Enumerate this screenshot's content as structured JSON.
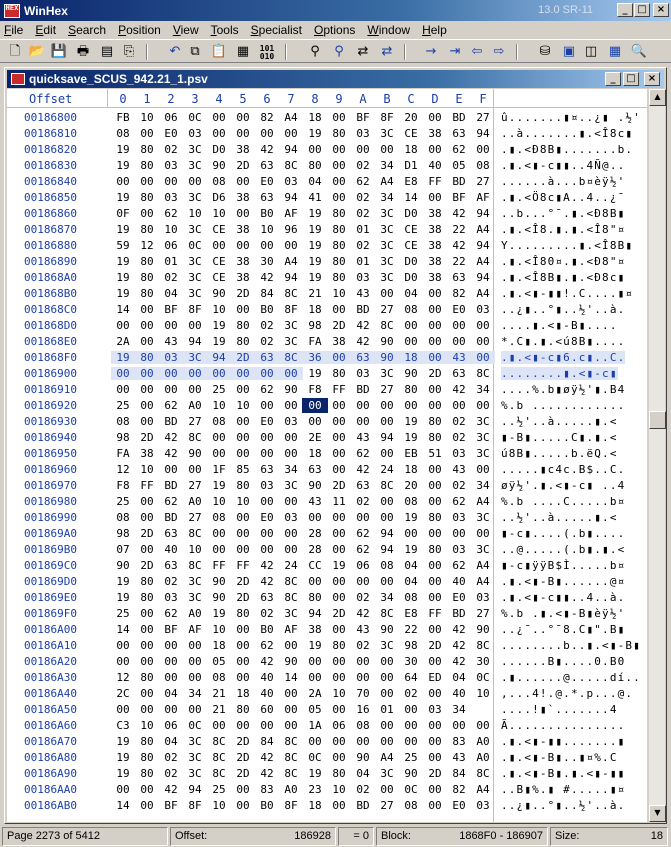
{
  "app": {
    "icon_text": "HEX",
    "title": "WinHex",
    "version": "13.0 SR-11"
  },
  "menu": [
    "File",
    "Edit",
    "Search",
    "Position",
    "View",
    "Tools",
    "Specialist",
    "Options",
    "Window",
    "Help"
  ],
  "toolbar": {
    "icons": [
      "new-file-icon",
      "open-folder-icon",
      "save-disk-icon",
      "print-icon",
      "properties-icon",
      "undo-icon",
      "copy-icon",
      "clipboard-icon",
      "paste-icon",
      "write-icon",
      "binary-convert-icon",
      "find-text-icon",
      "find-hex-icon",
      "replace-text-icon",
      "replace-hex-icon",
      "goto-offset-icon",
      "goto-sector-icon",
      "back-icon",
      "forward-icon",
      "disk-editor-icon",
      "ram-editor-icon",
      "position-manager-icon",
      "calculator-icon",
      "view-icon"
    ]
  },
  "editor": {
    "file_title": "quicksave_SCUS_942.21_1.psv",
    "header": {
      "offset_label": "Offset",
      "columns": [
        "0",
        "1",
        "2",
        "3",
        "4",
        "5",
        "6",
        "7",
        "8",
        "9",
        "A",
        "B",
        "C",
        "D",
        "E",
        "F"
      ]
    },
    "rows": [
      {
        "off": "00186800",
        "hex": [
          "FB",
          "10",
          "06",
          "0C",
          "00",
          "00",
          "82",
          "A4",
          "18",
          "00",
          "BF",
          "8F",
          "20",
          "00",
          "BD",
          "27"
        ],
        "txt": "û.......▮¤..¿▮ .½'"
      },
      {
        "off": "00186810",
        "hex": [
          "08",
          "00",
          "E0",
          "03",
          "00",
          "00",
          "00",
          "00",
          "19",
          "80",
          "03",
          "3C",
          "CE",
          "38",
          "63",
          "94"
        ],
        "txt": "..à.......▮.<Î8c▮"
      },
      {
        "off": "00186820",
        "hex": [
          "19",
          "80",
          "02",
          "3C",
          "D0",
          "38",
          "42",
          "94",
          "00",
          "00",
          "00",
          "00",
          "18",
          "00",
          "62",
          "00"
        ],
        "txt": ".▮.<Ð8B▮.......b."
      },
      {
        "off": "00186830",
        "hex": [
          "19",
          "80",
          "03",
          "3C",
          "90",
          "2D",
          "63",
          "8C",
          "80",
          "00",
          "02",
          "34",
          "D1",
          "40",
          "05",
          "08"
        ],
        "txt": ".▮.<▮-c▮▮..4Ñ@.."
      },
      {
        "off": "00186840",
        "hex": [
          "00",
          "00",
          "00",
          "00",
          "08",
          "00",
          "E0",
          "03",
          "04",
          "00",
          "62",
          "A4",
          "E8",
          "FF",
          "BD",
          "27"
        ],
        "txt": "......à...b¤èÿ½'"
      },
      {
        "off": "00186850",
        "hex": [
          "19",
          "80",
          "03",
          "3C",
          "D6",
          "38",
          "63",
          "94",
          "41",
          "00",
          "02",
          "34",
          "14",
          "00",
          "BF",
          "AF"
        ],
        "txt": ".▮.<Ö8c▮A..4..¿¯"
      },
      {
        "off": "00186860",
        "hex": [
          "0F",
          "00",
          "62",
          "10",
          "10",
          "00",
          "B0",
          "AF",
          "19",
          "80",
          "02",
          "3C",
          "D0",
          "38",
          "42",
          "94"
        ],
        "txt": "..b...°¯.▮.<Ð8B▮"
      },
      {
        "off": "00186870",
        "hex": [
          "19",
          "80",
          "10",
          "3C",
          "CE",
          "38",
          "10",
          "96",
          "19",
          "80",
          "01",
          "3C",
          "CE",
          "38",
          "22",
          "A4"
        ],
        "txt": ".▮.<Î8.▮.▮.<Î8\"¤"
      },
      {
        "off": "00186880",
        "hex": [
          "59",
          "12",
          "06",
          "0C",
          "00",
          "00",
          "00",
          "00",
          "19",
          "80",
          "02",
          "3C",
          "CE",
          "38",
          "42",
          "94"
        ],
        "txt": "Y.........▮.<Î8B▮"
      },
      {
        "off": "00186890",
        "hex": [
          "19",
          "80",
          "01",
          "3C",
          "CE",
          "38",
          "30",
          "A4",
          "19",
          "80",
          "01",
          "3C",
          "D0",
          "38",
          "22",
          "A4"
        ],
        "txt": ".▮.<Î80¤.▮.<Ð8\"¤"
      },
      {
        "off": "001868A0",
        "hex": [
          "19",
          "80",
          "02",
          "3C",
          "CE",
          "38",
          "42",
          "94",
          "19",
          "80",
          "03",
          "3C",
          "D0",
          "38",
          "63",
          "94"
        ],
        "txt": ".▮.<Î8B▮.▮.<Ð8c▮"
      },
      {
        "off": "001868B0",
        "hex": [
          "19",
          "80",
          "04",
          "3C",
          "90",
          "2D",
          "84",
          "8C",
          "21",
          "10",
          "43",
          "00",
          "04",
          "00",
          "82",
          "A4"
        ],
        "txt": ".▮.<▮-▮▮!.C....▮¤"
      },
      {
        "off": "001868C0",
        "hex": [
          "14",
          "00",
          "BF",
          "8F",
          "10",
          "00",
          "B0",
          "8F",
          "18",
          "00",
          "BD",
          "27",
          "08",
          "00",
          "E0",
          "03"
        ],
        "txt": "..¿▮..°▮..½'..à."
      },
      {
        "off": "001868D0",
        "hex": [
          "00",
          "00",
          "00",
          "00",
          "19",
          "80",
          "02",
          "3C",
          "98",
          "2D",
          "42",
          "8C",
          "00",
          "00",
          "00",
          "00"
        ],
        "txt": "....▮.<▮-B▮...."
      },
      {
        "off": "001868E0",
        "hex": [
          "2A",
          "00",
          "43",
          "94",
          "19",
          "80",
          "02",
          "3C",
          "FA",
          "38",
          "42",
          "90",
          "00",
          "00",
          "00",
          "00"
        ],
        "txt": "*.C▮.▮.<ú8B▮...."
      },
      {
        "off": "001868F0",
        "hex": [
          "19",
          "80",
          "03",
          "3C",
          "94",
          "2D",
          "63",
          "8C",
          "36",
          "00",
          "63",
          "90",
          "18",
          "00",
          "43",
          "00"
        ],
        "txt": ".▮.<▮-c▮6.c▮..C.",
        "sel": true
      },
      {
        "off": "00186900",
        "hex": [
          "00",
          "00",
          "00",
          "00",
          "00",
          "00",
          "00",
          "00",
          "19",
          "80",
          "03",
          "3C",
          "90",
          "2D",
          "63",
          "8C"
        ],
        "txt": "........▮.<▮-c▮",
        "selhex": 8
      },
      {
        "off": "00186910",
        "hex": [
          "00",
          "00",
          "00",
          "00",
          "25",
          "00",
          "62",
          "90",
          "F8",
          "FF",
          "BD",
          "27",
          "80",
          "00",
          "42",
          "34"
        ],
        "txt": "....%.b▮øÿ½'▮.B4"
      },
      {
        "off": "00186920",
        "hex": [
          "25",
          "00",
          "62",
          "A0",
          "10",
          "10",
          "00",
          "00",
          "00",
          "00",
          "00",
          "00",
          "00",
          "00",
          "00",
          "00"
        ],
        "txt": "%.b ............",
        "cursor": 8
      },
      {
        "off": "00186930",
        "hex": [
          "08",
          "00",
          "BD",
          "27",
          "08",
          "00",
          "E0",
          "03",
          "00",
          "00",
          "00",
          "00",
          "19",
          "80",
          "02",
          "3C"
        ],
        "txt": "..½'..à.....▮.<"
      },
      {
        "off": "00186940",
        "hex": [
          "98",
          "2D",
          "42",
          "8C",
          "00",
          "00",
          "00",
          "00",
          "2E",
          "00",
          "43",
          "94",
          "19",
          "80",
          "02",
          "3C"
        ],
        "txt": "▮-B▮.....C▮.▮.<"
      },
      {
        "off": "00186950",
        "hex": [
          "FA",
          "38",
          "42",
          "90",
          "00",
          "00",
          "00",
          "00",
          "18",
          "00",
          "62",
          "00",
          "EB",
          "51",
          "03",
          "3C"
        ],
        "txt": "ú8B▮.....b.ëQ.<"
      },
      {
        "off": "00186960",
        "hex": [
          "12",
          "10",
          "00",
          "00",
          "1F",
          "85",
          "63",
          "34",
          "63",
          "00",
          "42",
          "24",
          "18",
          "00",
          "43",
          "00"
        ],
        "txt": ".....▮c4c.B$..C."
      },
      {
        "off": "00186970",
        "hex": [
          "F8",
          "FF",
          "BD",
          "27",
          "19",
          "80",
          "03",
          "3C",
          "90",
          "2D",
          "63",
          "8C",
          "20",
          "00",
          "02",
          "34"
        ],
        "txt": "øÿ½'.▮.<▮-c▮ ..4"
      },
      {
        "off": "00186980",
        "hex": [
          "25",
          "00",
          "62",
          "A0",
          "10",
          "10",
          "00",
          "00",
          "43",
          "11",
          "02",
          "00",
          "08",
          "00",
          "62",
          "A4"
        ],
        "txt": "%.b ....C.....b¤"
      },
      {
        "off": "00186990",
        "hex": [
          "08",
          "00",
          "BD",
          "27",
          "08",
          "00",
          "E0",
          "03",
          "00",
          "00",
          "00",
          "00",
          "19",
          "80",
          "03",
          "3C"
        ],
        "txt": "..½'..à.....▮.<"
      },
      {
        "off": "001869A0",
        "hex": [
          "98",
          "2D",
          "63",
          "8C",
          "00",
          "00",
          "00",
          "00",
          "28",
          "00",
          "62",
          "94",
          "00",
          "00",
          "00",
          "00"
        ],
        "txt": "▮-c▮....(.b▮...."
      },
      {
        "off": "001869B0",
        "hex": [
          "07",
          "00",
          "40",
          "10",
          "00",
          "00",
          "00",
          "00",
          "28",
          "00",
          "62",
          "94",
          "19",
          "80",
          "03",
          "3C"
        ],
        "txt": "..@.....(.b▮.▮.<"
      },
      {
        "off": "001869C0",
        "hex": [
          "90",
          "2D",
          "63",
          "8C",
          "FF",
          "FF",
          "42",
          "24",
          "CC",
          "19",
          "06",
          "08",
          "04",
          "00",
          "62",
          "A4"
        ],
        "txt": "▮-c▮ÿÿB$Ì.....b¤"
      },
      {
        "off": "001869D0",
        "hex": [
          "19",
          "80",
          "02",
          "3C",
          "90",
          "2D",
          "42",
          "8C",
          "00",
          "00",
          "00",
          "00",
          "04",
          "00",
          "40",
          "A4"
        ],
        "txt": ".▮.<▮-B▮......@¤"
      },
      {
        "off": "001869E0",
        "hex": [
          "19",
          "80",
          "03",
          "3C",
          "90",
          "2D",
          "63",
          "8C",
          "80",
          "00",
          "02",
          "34",
          "08",
          "00",
          "E0",
          "03"
        ],
        "txt": ".▮.<▮-c▮▮..4..à."
      },
      {
        "off": "001869F0",
        "hex": [
          "25",
          "00",
          "62",
          "A0",
          "19",
          "80",
          "02",
          "3C",
          "94",
          "2D",
          "42",
          "8C",
          "E8",
          "FF",
          "BD",
          "27"
        ],
        "txt": "%.b .▮.<▮-B▮èÿ½'"
      },
      {
        "off": "00186A00",
        "hex": [
          "14",
          "00",
          "BF",
          "AF",
          "10",
          "00",
          "B0",
          "AF",
          "38",
          "00",
          "43",
          "90",
          "22",
          "00",
          "42",
          "90"
        ],
        "txt": "..¿¯..°¯8.C▮\".B▮"
      },
      {
        "off": "00186A10",
        "hex": [
          "00",
          "00",
          "00",
          "00",
          "18",
          "00",
          "62",
          "00",
          "19",
          "80",
          "02",
          "3C",
          "98",
          "2D",
          "42",
          "8C"
        ],
        "txt": "........b..▮.<▮-B▮"
      },
      {
        "off": "00186A20",
        "hex": [
          "00",
          "00",
          "00",
          "00",
          "05",
          "00",
          "42",
          "90",
          "00",
          "00",
          "00",
          "00",
          "30",
          "00",
          "42",
          "30"
        ],
        "txt": "......B▮....0.B0"
      },
      {
        "off": "00186A30",
        "hex": [
          "12",
          "80",
          "00",
          "00",
          "08",
          "00",
          "40",
          "14",
          "00",
          "00",
          "00",
          "00",
          "64",
          "ED",
          "04",
          "0C"
        ],
        "txt": ".▮......@.....dí.."
      },
      {
        "off": "00186A40",
        "hex": [
          "2C",
          "00",
          "04",
          "34",
          "21",
          "18",
          "40",
          "00",
          "2A",
          "10",
          "70",
          "00",
          "02",
          "00",
          "40",
          "10"
        ],
        "txt": ",...4!.@.*.p...@."
      },
      {
        "off": "00186A50",
        "hex": [
          "00",
          "00",
          "00",
          "00",
          "21",
          "80",
          "60",
          "00",
          "05",
          "00",
          "16",
          "01",
          "00",
          "03",
          "34"
        ],
        "txt": "....!▮`.......4"
      },
      {
        "off": "00186A60",
        "hex": [
          "C3",
          "10",
          "06",
          "0C",
          "00",
          "00",
          "00",
          "00",
          "1A",
          "06",
          "08",
          "00",
          "00",
          "00",
          "00",
          "00"
        ],
        "txt": "Ã..............."
      },
      {
        "off": "00186A70",
        "hex": [
          "19",
          "80",
          "04",
          "3C",
          "8C",
          "2D",
          "84",
          "8C",
          "00",
          "00",
          "00",
          "00",
          "00",
          "00",
          "83",
          "A0"
        ],
        "txt": ".▮.<▮-▮▮.......▮ "
      },
      {
        "off": "00186A80",
        "hex": [
          "19",
          "80",
          "02",
          "3C",
          "8C",
          "2D",
          "42",
          "8C",
          "0C",
          "00",
          "90",
          "A4",
          "25",
          "00",
          "43",
          "A0"
        ],
        "txt": ".▮.<▮-B▮..▮¤%.C "
      },
      {
        "off": "00186A90",
        "hex": [
          "19",
          "80",
          "02",
          "3C",
          "8C",
          "2D",
          "42",
          "8C",
          "19",
          "80",
          "04",
          "3C",
          "90",
          "2D",
          "84",
          "8C"
        ],
        "txt": ".▮.<▮-B▮.▮.<▮-▮▮"
      },
      {
        "off": "00186AA0",
        "hex": [
          "00",
          "00",
          "42",
          "94",
          "25",
          "00",
          "83",
          "A0",
          "23",
          "10",
          "02",
          "00",
          "0C",
          "00",
          "82",
          "A4"
        ],
        "txt": "..B▮%.▮ #.....▮¤"
      },
      {
        "off": "00186AB0",
        "hex": [
          "14",
          "00",
          "BF",
          "8F",
          "10",
          "00",
          "B0",
          "8F",
          "18",
          "00",
          "BD",
          "27",
          "08",
          "00",
          "E0",
          "03"
        ],
        "txt": "..¿▮..°▮..½'..à."
      }
    ]
  },
  "status": {
    "page": "Page 2273 of 5412",
    "offset_label": "Offset:",
    "offset_value": "186928",
    "value": "= 0",
    "block_label": "Block:",
    "block_value": "1868F0 - 186907",
    "size_label": "Size:",
    "size_value": "18"
  }
}
